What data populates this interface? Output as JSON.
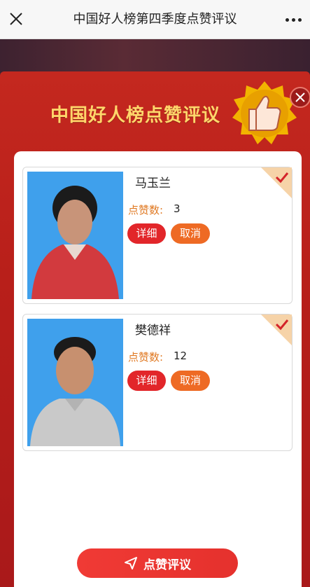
{
  "header": {
    "title": "中国好人榜第四季度点赞评议"
  },
  "modal": {
    "title": "中国好人榜点赞评议"
  },
  "candidates": [
    {
      "name": "马玉兰",
      "likes_label": "点赞数:",
      "likes": "3",
      "detail_label": "详细",
      "cancel_label": "取消"
    },
    {
      "name": "樊德祥",
      "likes_label": "点赞数:",
      "likes": "12",
      "detail_label": "详细",
      "cancel_label": "取消"
    }
  ],
  "vote_button": {
    "label": "点赞评议"
  },
  "colors": {
    "accent_red": "#e2262a",
    "accent_orange": "#ee6a24",
    "title_gold": "#ffd66b"
  },
  "icons": [
    "close-icon",
    "more-icon",
    "thumbs-up-badge-icon",
    "modal-close-icon",
    "checkmark-icon",
    "send-icon"
  ]
}
